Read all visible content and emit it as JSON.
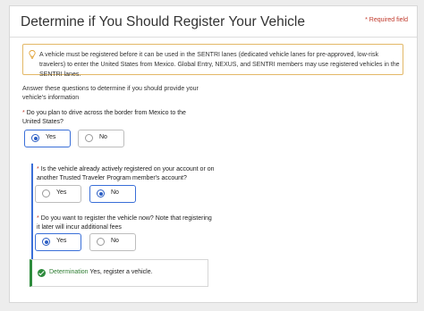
{
  "header": {
    "title": "Determine if You Should Register Your Vehicle",
    "required_star": "*",
    "required_label": "Required field"
  },
  "info": {
    "text": "A vehicle must be registered before it can be used in the SENTRI lanes (dedicated vehicle lanes for pre-approved, low-risk travelers) to enter the United States from Mexico. Global Entry, NEXUS, and SENTRI members may use registered vehicles in the SENTRI lanes."
  },
  "intro": "Answer these questions to determine if you should provide your vehicle's information",
  "questions": [
    {
      "star": "*",
      "text": "Do you plan to drive across the border from Mexico to the United States?",
      "options": [
        "Yes",
        "No"
      ],
      "selected": "Yes"
    },
    {
      "star": "*",
      "text": "Is the vehicle already actively registered on your account or on another Trusted Traveler Program member's account?",
      "options": [
        "Yes",
        "No"
      ],
      "selected": "No"
    },
    {
      "star": "*",
      "text": "Do you want to register the vehicle now? Note that registering it later will incur additional fees",
      "options": [
        "Yes",
        "No"
      ],
      "selected": "Yes"
    }
  ],
  "determination": {
    "label": "Determination",
    "text": "Yes, register a vehicle."
  },
  "colors": {
    "accent": "#3a6fd8",
    "required": "#c0392b",
    "success": "#2e8b3d",
    "info_border": "#e3b867"
  }
}
